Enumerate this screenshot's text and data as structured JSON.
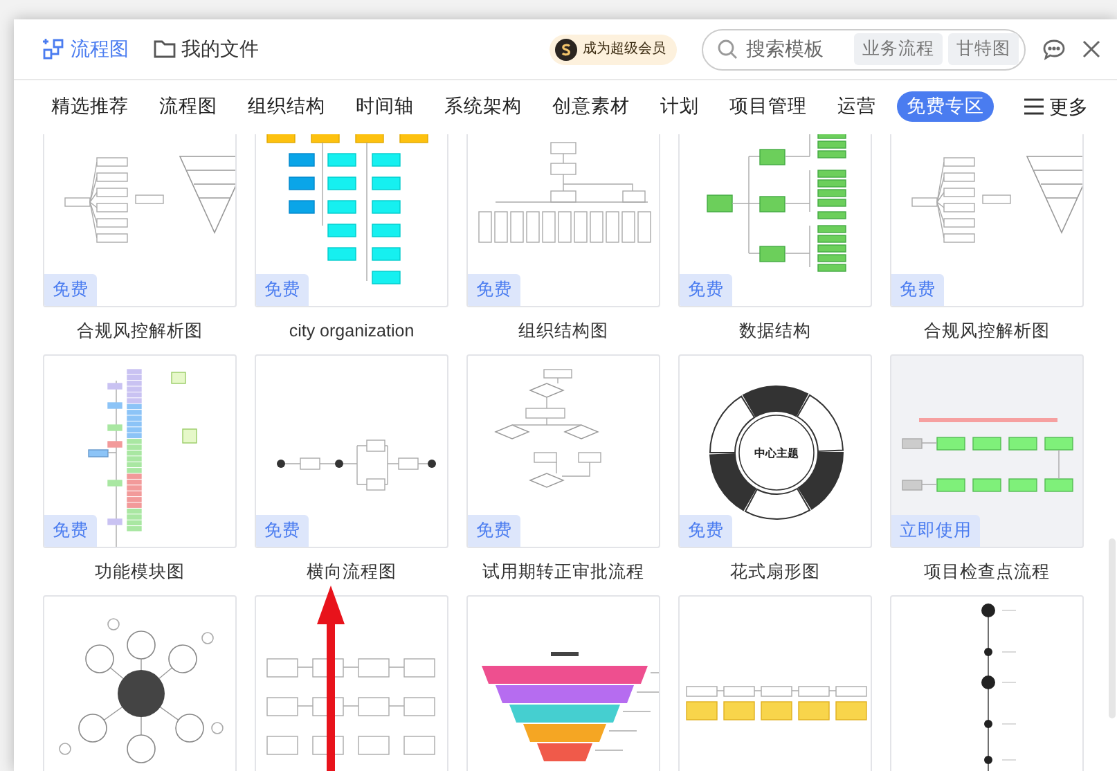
{
  "header": {
    "tabs": [
      {
        "label": "流程图",
        "selected": true
      },
      {
        "label": "我的文件",
        "selected": false
      }
    ],
    "vip": "成为超级会员",
    "search": {
      "placeholder": "搜索模板",
      "tags": [
        "业务流程",
        "甘特图"
      ]
    }
  },
  "categories": [
    {
      "label": "精选推荐",
      "selected": false
    },
    {
      "label": "流程图",
      "selected": false
    },
    {
      "label": "组织结构",
      "selected": false
    },
    {
      "label": "时间轴",
      "selected": false
    },
    {
      "label": "系统架构",
      "selected": false
    },
    {
      "label": "创意素材",
      "selected": false
    },
    {
      "label": "计划",
      "selected": false
    },
    {
      "label": "项目管理",
      "selected": false
    },
    {
      "label": "运营",
      "selected": false
    },
    {
      "label": "免费专区",
      "selected": true
    }
  ],
  "more": "更多",
  "templates": [
    {
      "title": "合规风控解析图",
      "badge": "免费",
      "kind": "funnel",
      "hovered": false
    },
    {
      "title": "city organization",
      "badge": "免费",
      "kind": "org-color",
      "hovered": false
    },
    {
      "title": "组织结构图",
      "badge": "免费",
      "kind": "org-outline",
      "hovered": false
    },
    {
      "title": "数据结构",
      "badge": "免费",
      "kind": "tree-green",
      "hovered": false
    },
    {
      "title": "合规风控解析图",
      "badge": "免费",
      "kind": "funnel",
      "hovered": false
    },
    {
      "title": "功能模块图",
      "badge": "免费",
      "kind": "module-tree",
      "hovered": false
    },
    {
      "title": "横向流程图",
      "badge": "免费",
      "kind": "flow-line",
      "hovered": false
    },
    {
      "title": "试用期转正审批流程",
      "badge": "免费",
      "kind": "flowchart",
      "hovered": false
    },
    {
      "title": "花式扇形图",
      "badge": "免费",
      "kind": "fan",
      "caption": "中心主题",
      "hovered": false
    },
    {
      "title": "项目检查点流程",
      "badge": "立即使用",
      "kind": "checkpoint",
      "hovered": true
    },
    {
      "kind": "bubble",
      "hovered": false
    },
    {
      "kind": "process-grid",
      "hovered": false
    },
    {
      "kind": "funnel-color",
      "hovered": false
    },
    {
      "kind": "process-yellow",
      "hovered": false
    },
    {
      "kind": "timeline",
      "hovered": false
    }
  ],
  "annotation": {
    "kind": "arrow"
  }
}
